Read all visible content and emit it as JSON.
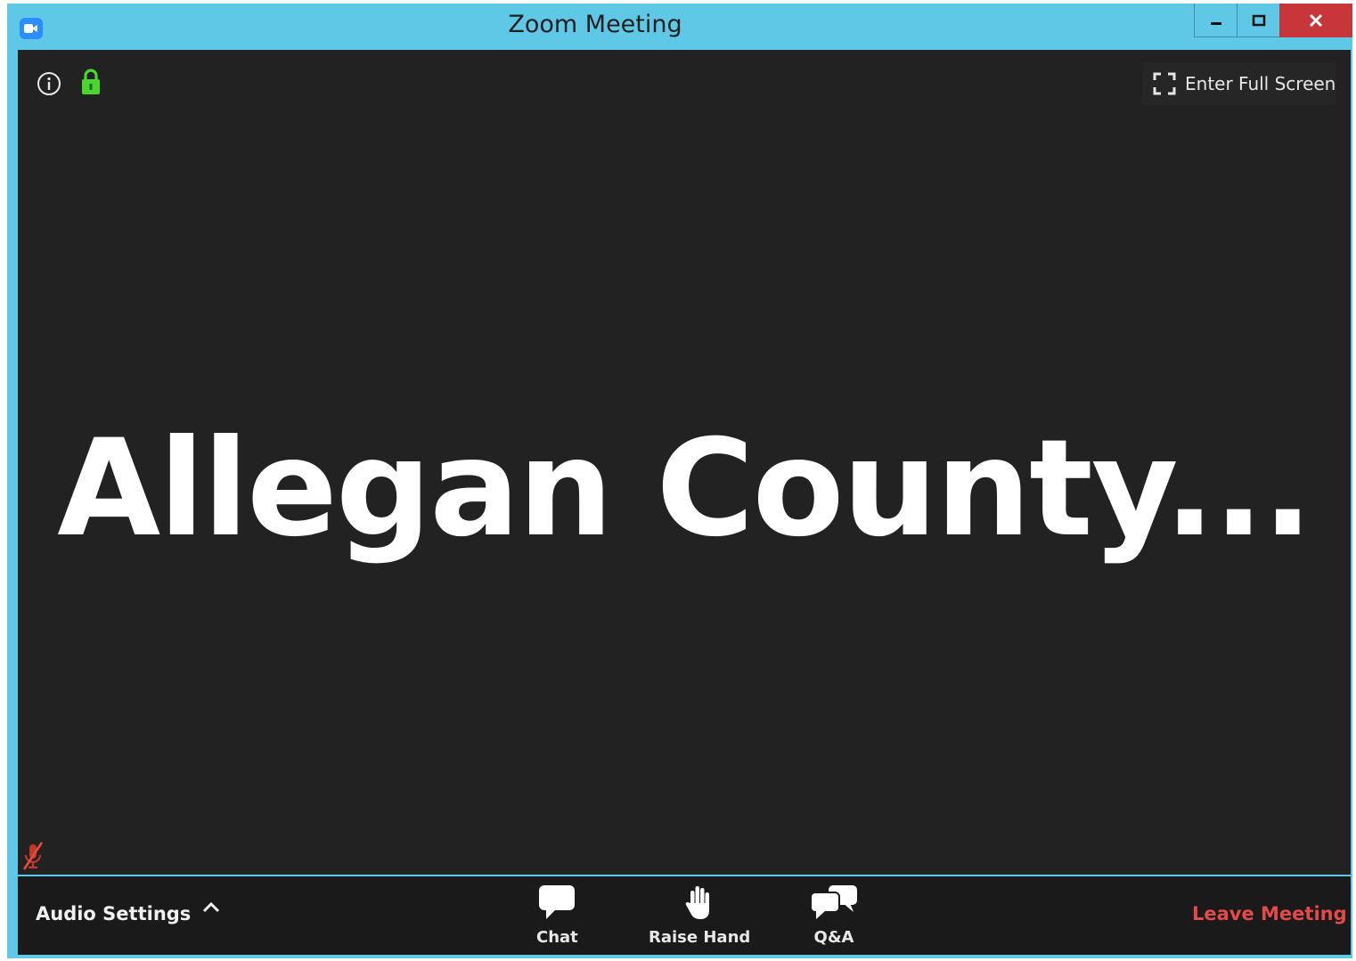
{
  "window": {
    "title": "Zoom Meeting"
  },
  "header": {
    "fullscreen_label": "Enter Full Screen"
  },
  "main": {
    "display_text": "Allegan County..."
  },
  "toolbar": {
    "audio_settings_label": "Audio Settings",
    "chat_label": "Chat",
    "raise_hand_label": "Raise Hand",
    "qa_label": "Q&A",
    "leave_label": "Leave Meeting"
  },
  "colors": {
    "titlebar": "#5ec8e6",
    "stage": "#222222",
    "toolbar": "#1a1a1a",
    "lock": "#4cd431",
    "leave": "#e34a4a",
    "close": "#c7373a"
  },
  "icons": [
    "zoom-app-icon",
    "minimize-icon",
    "maximize-icon",
    "close-icon",
    "info-icon",
    "lock-icon",
    "fullscreen-icon",
    "muted-mic-icon",
    "caret-up-icon",
    "chat-icon",
    "raise-hand-icon",
    "qa-icon"
  ]
}
